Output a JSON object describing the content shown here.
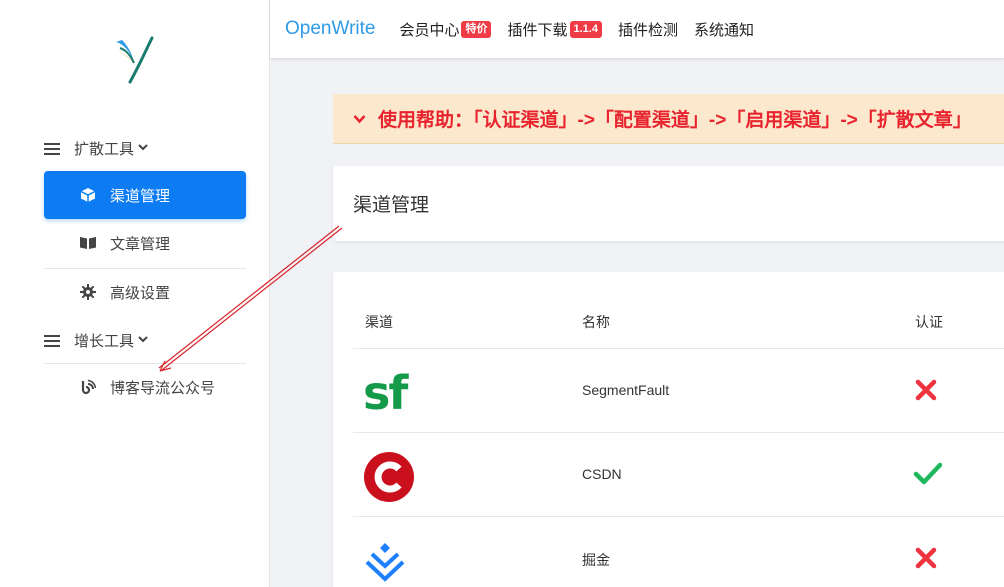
{
  "sidebar": {
    "groups": [
      {
        "label": "扩散工具",
        "chevron": "⌄"
      },
      {
        "label": "增长工具",
        "chevron": "⌄"
      }
    ],
    "items": [
      {
        "label": "渠道管理",
        "icon": "cube-icon",
        "active": true
      },
      {
        "label": "文章管理",
        "icon": "book-icon"
      },
      {
        "label": "高级设置",
        "icon": "gear-icon"
      },
      {
        "label": "博客导流公众号",
        "icon": "blog-icon"
      }
    ]
  },
  "topbar": {
    "brand": "OpenWrite",
    "nav": [
      {
        "label": "会员中心",
        "badge": "特价"
      },
      {
        "label": "插件下载",
        "badge": "1.1.4"
      },
      {
        "label": "插件检测"
      },
      {
        "label": "系统通知"
      }
    ]
  },
  "help_banner": {
    "text": "使用帮助：「认证渠道」->「配置渠道」->「启用渠道」->「扩散文章」"
  },
  "page": {
    "title": "渠道管理"
  },
  "table": {
    "headers": {
      "channel": "渠道",
      "name": "名称",
      "auth": "认证"
    },
    "rows": [
      {
        "logo": "sf",
        "logo_icon": "segmentfault-logo",
        "name": "SegmentFault",
        "auth": false
      },
      {
        "logo": "",
        "logo_icon": "csdn-logo",
        "name": "CSDN",
        "auth": true
      },
      {
        "logo": "",
        "logo_icon": "juejin-logo",
        "name": "掘金",
        "auth": false
      }
    ]
  },
  "colors": {
    "primary": "#0d7cf2",
    "brand": "#2f9ae6",
    "badge": "#ef3b46",
    "help_bg": "#fbe8cd",
    "help_text": "#e8242f",
    "check": "#1fb85c",
    "cross": "#ee3340"
  }
}
